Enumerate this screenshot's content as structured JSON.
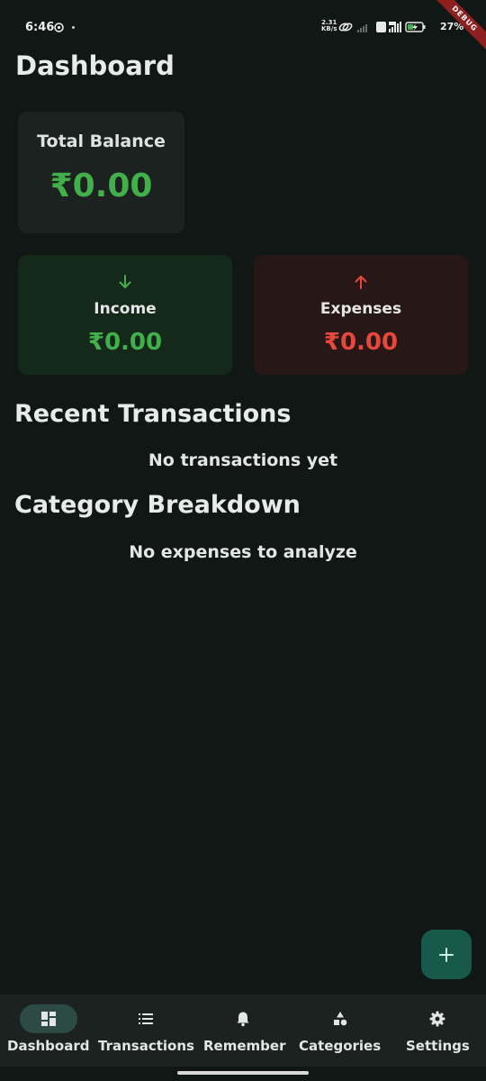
{
  "status_bar": {
    "time": "6:46",
    "net_speed_value": "2.31",
    "net_speed_unit": "KB/s",
    "battery": "27%",
    "debug_label": "DEBUG"
  },
  "page": {
    "title": "Dashboard"
  },
  "balance": {
    "label": "Total Balance",
    "value": "₹0.00"
  },
  "income": {
    "label": "Income",
    "value": "₹0.00",
    "color": "#41b04a"
  },
  "expenses": {
    "label": "Expenses",
    "value": "₹0.00",
    "color": "#e8473b"
  },
  "recent": {
    "title": "Recent Transactions",
    "empty_text": "No transactions yet"
  },
  "category": {
    "title": "Category Breakdown",
    "empty_text": "No expenses to analyze"
  },
  "fab": {
    "icon": "plus-icon"
  },
  "nav": {
    "items": [
      {
        "label": "Dashboard",
        "icon": "dashboard-icon",
        "active": true
      },
      {
        "label": "Transactions",
        "icon": "list-icon",
        "active": false
      },
      {
        "label": "Remember",
        "icon": "bell-icon",
        "active": false
      },
      {
        "label": "Categories",
        "icon": "shapes-icon",
        "active": false
      },
      {
        "label": "Settings",
        "icon": "gear-icon",
        "active": false
      }
    ]
  }
}
